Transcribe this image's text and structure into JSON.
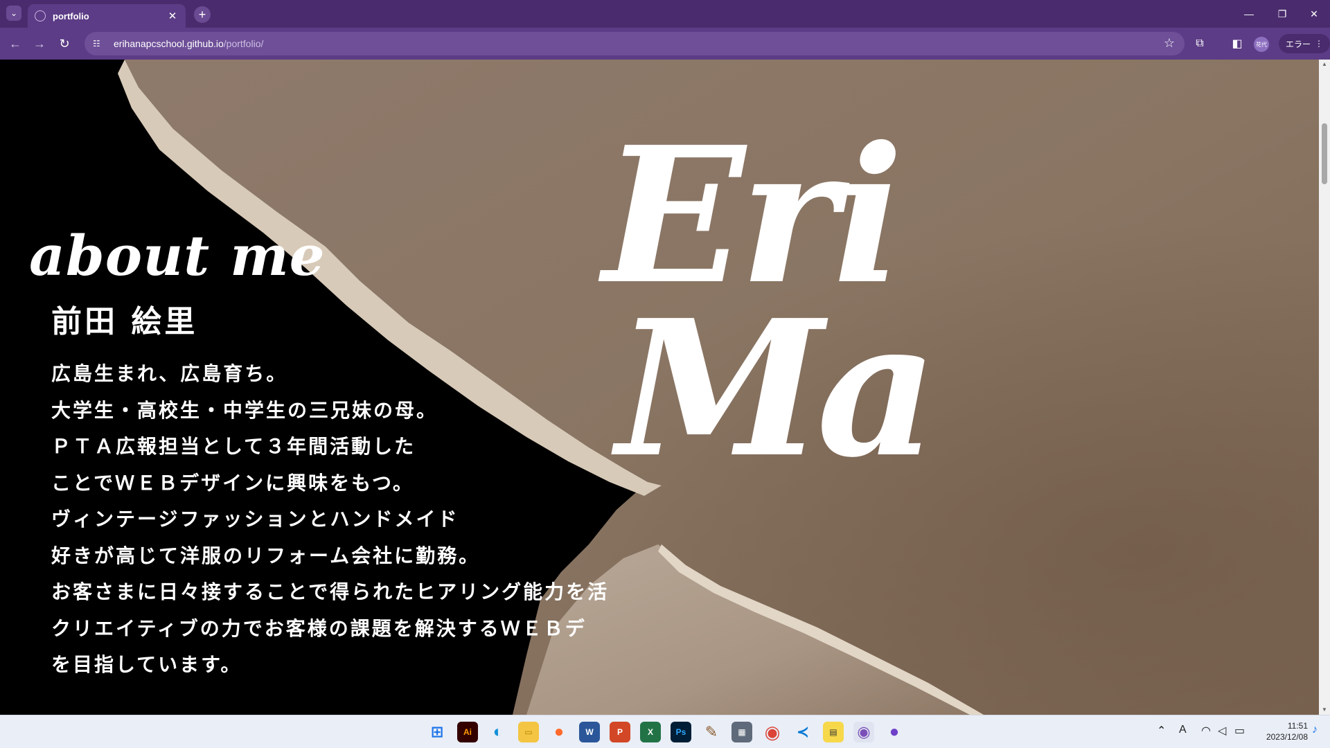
{
  "browser": {
    "tab_title": "portfolio",
    "url_host": "erihanapcschool.github.io",
    "url_path": "/portfolio/",
    "profile_label": "花代",
    "error_label": "エラー",
    "accent_color": "#5c3c86"
  },
  "page": {
    "about_title": "about me",
    "name": "前田 絵里",
    "bio_lines": [
      "広島生まれ、広島育ち。",
      "大学生・高校生・中学生の三兄妹の母。",
      "ＰＴＡ広報担当として３年間活動した",
      "ことでＷＥＢデザインに興味をもつ。",
      "ヴィンテージファッションとハンドメイド",
      "好きが高じて洋服のリフォーム会社に勤務。",
      "お客さまに日々接することで得られたヒアリング能力を活",
      "クリエイティブの力でお客様の課題を解決するＷＥＢデ",
      "を目指しています。"
    ],
    "logo_line1": "Eri",
    "logo_line2": "Ma"
  },
  "taskbar": {
    "apps": [
      "windows-start",
      "illustrator",
      "edge",
      "file-explorer",
      "firefox",
      "word",
      "powerpoint",
      "excel",
      "photoshop",
      "paint-tool",
      "calculator",
      "chrome",
      "vscode",
      "sticky-notes",
      "chrome-profile",
      "github-desktop"
    ],
    "time": "11:51",
    "date": "2023/12/08"
  }
}
